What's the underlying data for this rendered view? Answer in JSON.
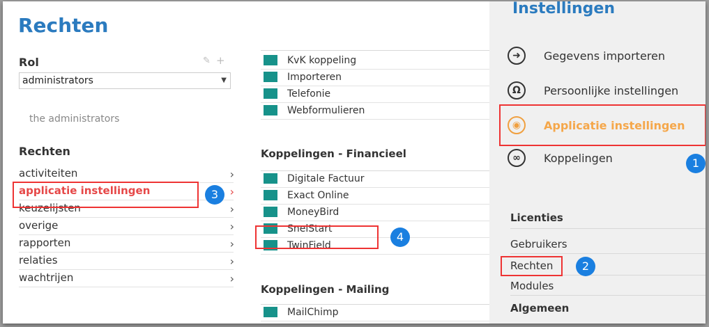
{
  "page": {
    "title": "Rechten"
  },
  "rol": {
    "label": "Rol",
    "selected": "administrators",
    "description": "the administrators"
  },
  "rights": {
    "heading": "Rechten",
    "items": [
      {
        "label": "activiteiten"
      },
      {
        "label": "applicatie instellingen",
        "active": true
      },
      {
        "label": "keuzelijsten"
      },
      {
        "label": "overige"
      },
      {
        "label": "rapporten"
      },
      {
        "label": "relaties"
      },
      {
        "label": "wachtrijen"
      }
    ]
  },
  "permissions": {
    "top_items": [
      "KvK koppeling",
      "Importeren",
      "Telefonie",
      "Webformulieren"
    ],
    "groups": [
      {
        "title": "Koppelingen - Financieel",
        "items": [
          "Digitale Factuur",
          "Exact Online",
          "MoneyBird",
          "SnelStart",
          "TwinField"
        ]
      },
      {
        "title": "Koppelingen - Mailing",
        "items": [
          "MailChimp"
        ]
      }
    ]
  },
  "settings_panel": {
    "title": "Instellingen",
    "items": [
      {
        "label": "Gegevens importeren",
        "icon": "arrow-right-circle-icon"
      },
      {
        "label": "Persoonlijke instellingen",
        "icon": "user-circle-icon"
      },
      {
        "label": "Applicatie instellingen",
        "icon": "location-pin-icon",
        "active": true
      },
      {
        "label": "Koppelingen",
        "icon": "link-circle-icon"
      }
    ],
    "licenties": {
      "heading": "Licenties",
      "items": [
        "Gebruikers",
        "Rechten",
        "Modules"
      ]
    },
    "algemeen": {
      "heading": "Algemeen"
    }
  },
  "callouts": {
    "one": "1",
    "two": "2",
    "three": "3",
    "four": "4"
  },
  "colors": {
    "title_blue": "#2b7bbf",
    "highlight_red": "#e33333",
    "active_orange": "#f5a74a",
    "teal_square": "#17928a",
    "badge_blue": "#1a7fe0"
  }
}
